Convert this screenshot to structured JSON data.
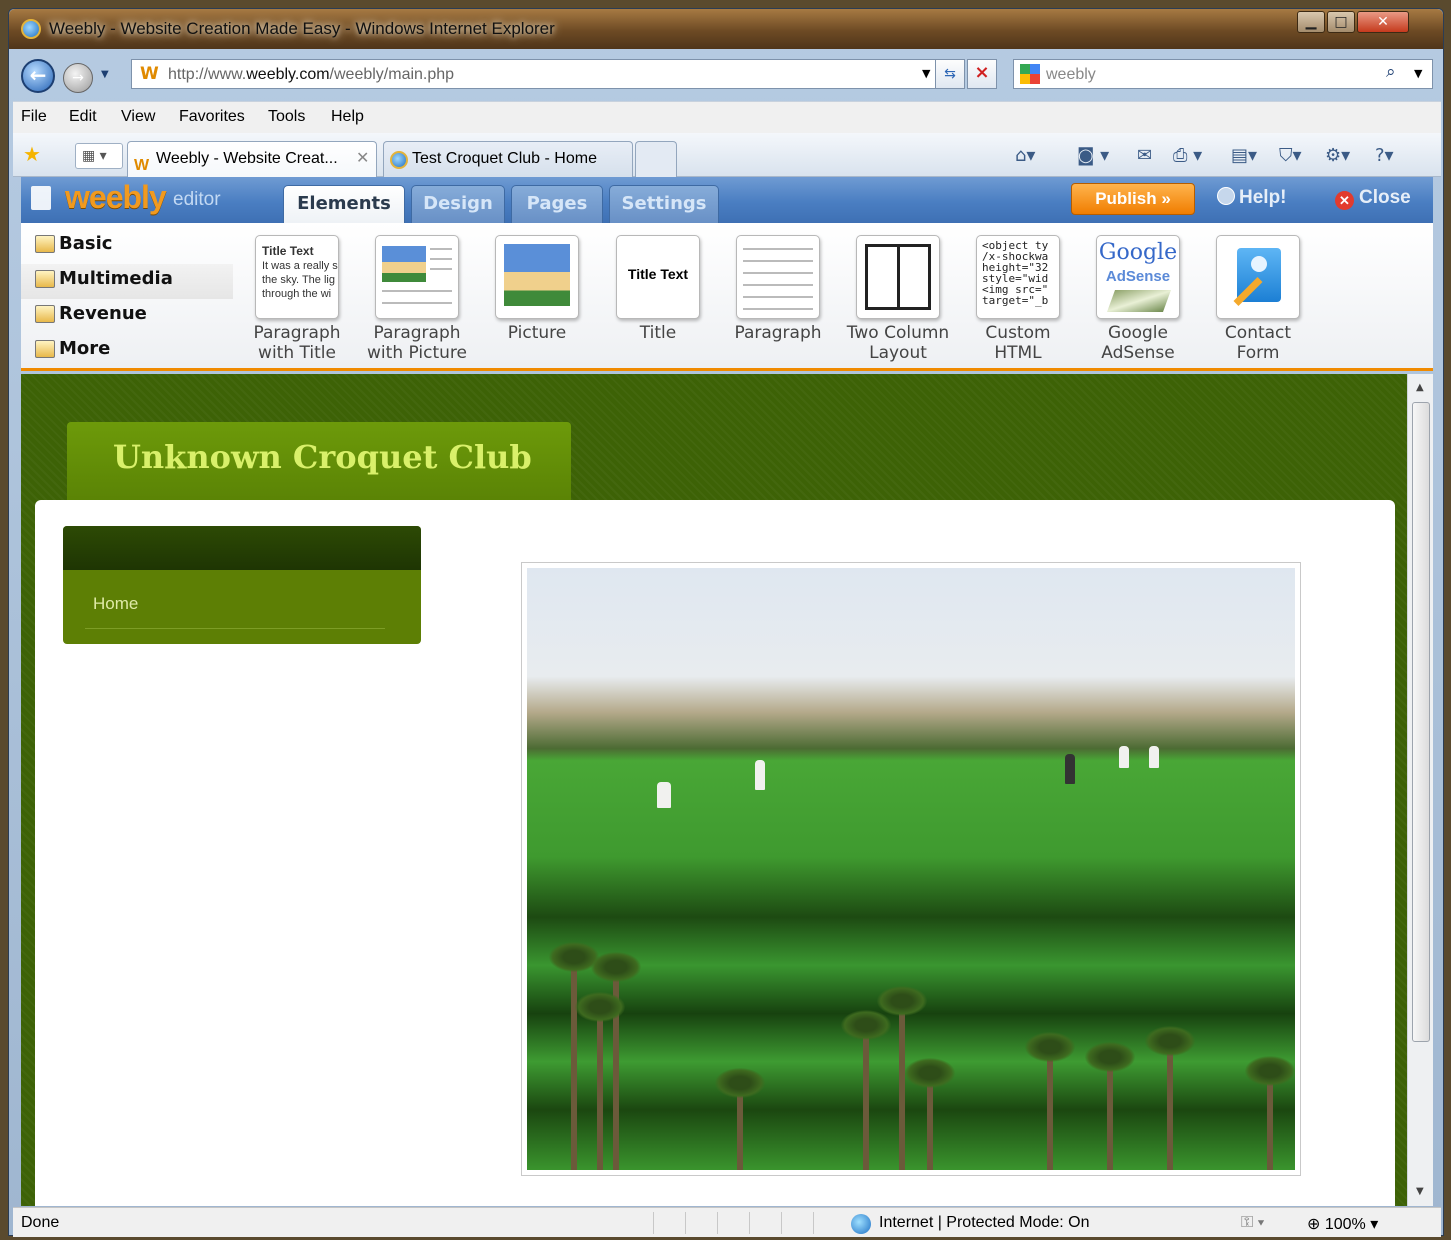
{
  "browser": {
    "title": "Weebly - Website Creation Made Easy - Windows Internet Explorer",
    "address_prefix": "http://www.",
    "address_domain": "weebly.com",
    "address_path": "/weebly/main.php",
    "search_text": "weebly",
    "menu": [
      "File",
      "Edit",
      "View",
      "Favorites",
      "Tools",
      "Help"
    ],
    "tabs": [
      {
        "label": "Weebly - Website Creat..."
      },
      {
        "label": "Test Croquet Club - Home"
      }
    ]
  },
  "editor": {
    "logo": "weebly",
    "logo_suffix": "editor",
    "tabs": [
      "Elements",
      "Design",
      "Pages",
      "Settings"
    ],
    "publish_label": "Publish »",
    "help_label": "Help!",
    "close_label": "Close",
    "categories": [
      "Basic",
      "Multimedia",
      "Revenue",
      "More"
    ],
    "elements": [
      {
        "line1": "Paragraph",
        "line2": "with Title"
      },
      {
        "line1": "Paragraph",
        "line2": "with Picture"
      },
      {
        "line1": "Picture",
        "line2": ""
      },
      {
        "line1": "Title",
        "line2": ""
      },
      {
        "line1": "Paragraph",
        "line2": ""
      },
      {
        "line1": "Two Column",
        "line2": "Layout"
      },
      {
        "line1": "Custom",
        "line2": "HTML"
      },
      {
        "line1": "Google",
        "line2": "AdSense"
      },
      {
        "line1": "Contact",
        "line2": "Form"
      }
    ],
    "thumbs": {
      "title_text": "Title Text",
      "para_lines": [
        "It was a really s",
        "the sky. The lig",
        "through the wi"
      ],
      "code": "<object ty\n/x-shockwa\nheight=\"32\nstyle=\"wid\n<img src=\"\ntarget=\"_b",
      "google": "Google",
      "adsense": "AdSense"
    }
  },
  "site": {
    "title": "Unknown Croquet Club",
    "nav": [
      "Home"
    ]
  },
  "status": {
    "left": "Done",
    "zone": "Internet | Protected Mode: On",
    "zoom": "100%"
  },
  "icons": {
    "ie": "internet-explorer-icon",
    "back": "back-arrow-icon",
    "forward": "forward-arrow-icon",
    "refresh": "refresh-icon",
    "stop": "stop-icon",
    "search": "search-icon",
    "favorites": "star-icon",
    "home": "home-icon",
    "feeds": "rss-icon",
    "print": "print-icon",
    "globe": "globe-icon",
    "zoom": "zoom-icon"
  }
}
